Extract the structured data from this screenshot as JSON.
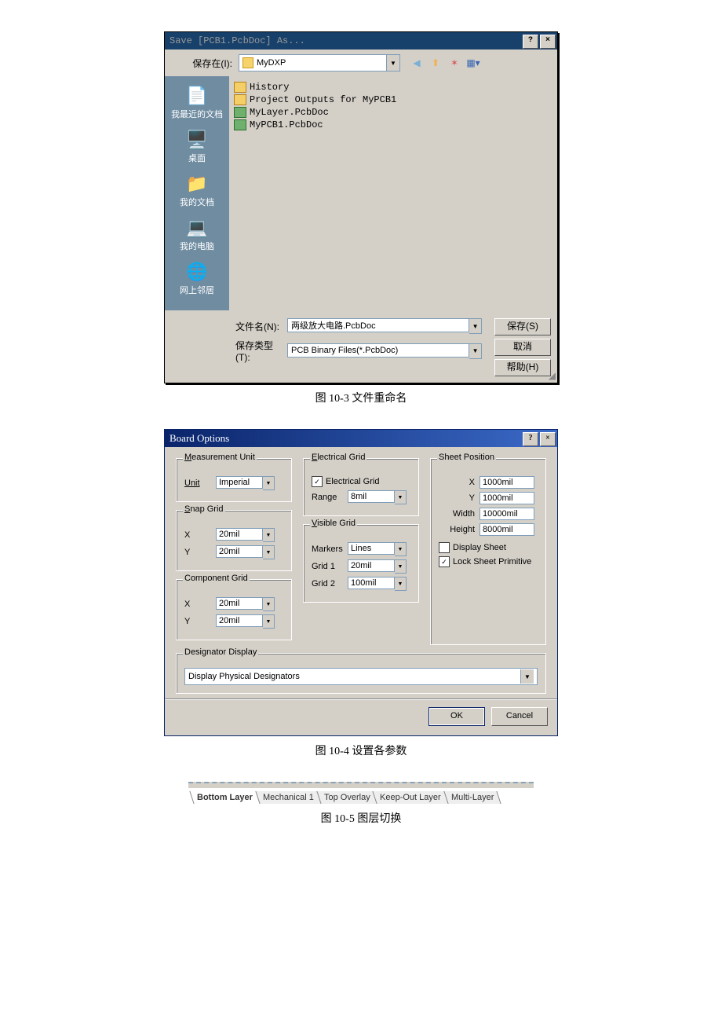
{
  "saveas": {
    "title": "Save [PCB1.PcbDoc] As...",
    "save_in_label": "保存在(I):",
    "save_in_value": "MyDXP",
    "places": {
      "recent": "我最近的文档",
      "desktop": "桌面",
      "mydocs": "我的文档",
      "mycomputer": "我的电脑",
      "network": "网上邻居"
    },
    "files": [
      "History",
      "Project Outputs for MyPCB1",
      "MyLayer.PcbDoc",
      "MyPCB1.PcbDoc"
    ],
    "filename_label": "文件名(N):",
    "filename_value": "两级放大电路.PcbDoc",
    "type_label": "保存类型(T):",
    "type_value": "PCB Binary Files(*.PcbDoc)",
    "btn_save": "保存(S)",
    "btn_cancel": "取消",
    "btn_help": "帮助(H)"
  },
  "captions": {
    "c1": "图 10-3 文件重命名",
    "c2": "图 10-4 设置各参数",
    "c3": "图 10-5   图层切换"
  },
  "board": {
    "title": "Board Options",
    "mu_legend": "Measurement Unit",
    "unit_label": "Unit",
    "unit_value": "Imperial",
    "sg_legend": "Snap Grid",
    "sg_x": "20mil",
    "sg_y": "20mil",
    "cg_legend": "Component Grid",
    "cg_x": "20mil",
    "cg_y": "20mil",
    "eg_legend": "Electrical Grid",
    "eg_chk": "Electrical Grid",
    "eg_range_label": "Range",
    "eg_range": "8mil",
    "vg_legend": "Visible Grid",
    "vg_markers_label": "Markers",
    "vg_markers": "Lines",
    "vg_g1_label": "Grid 1",
    "vg_g1": "20mil",
    "vg_g2_label": "Grid 2",
    "vg_g2": "100mil",
    "sp_legend": "Sheet Position",
    "sp_x": "1000mil",
    "sp_y": "1000mil",
    "sp_w_label": "Width",
    "sp_w": "10000mil",
    "sp_h_label": "Height",
    "sp_h": "8000mil",
    "sp_display": "Display Sheet",
    "sp_lock": "Lock Sheet Primitive",
    "dd_legend": "Designator Display",
    "dd_value": "Display Physical Designators",
    "btn_ok": "OK",
    "btn_cancel": "Cancel",
    "lbl_x": "X",
    "lbl_y": "Y"
  },
  "tabs": {
    "t1": "Bottom Layer",
    "t2": "Mechanical 1",
    "t3": "Top Overlay",
    "t4": "Keep-Out Layer",
    "t5": "Multi-Layer"
  }
}
